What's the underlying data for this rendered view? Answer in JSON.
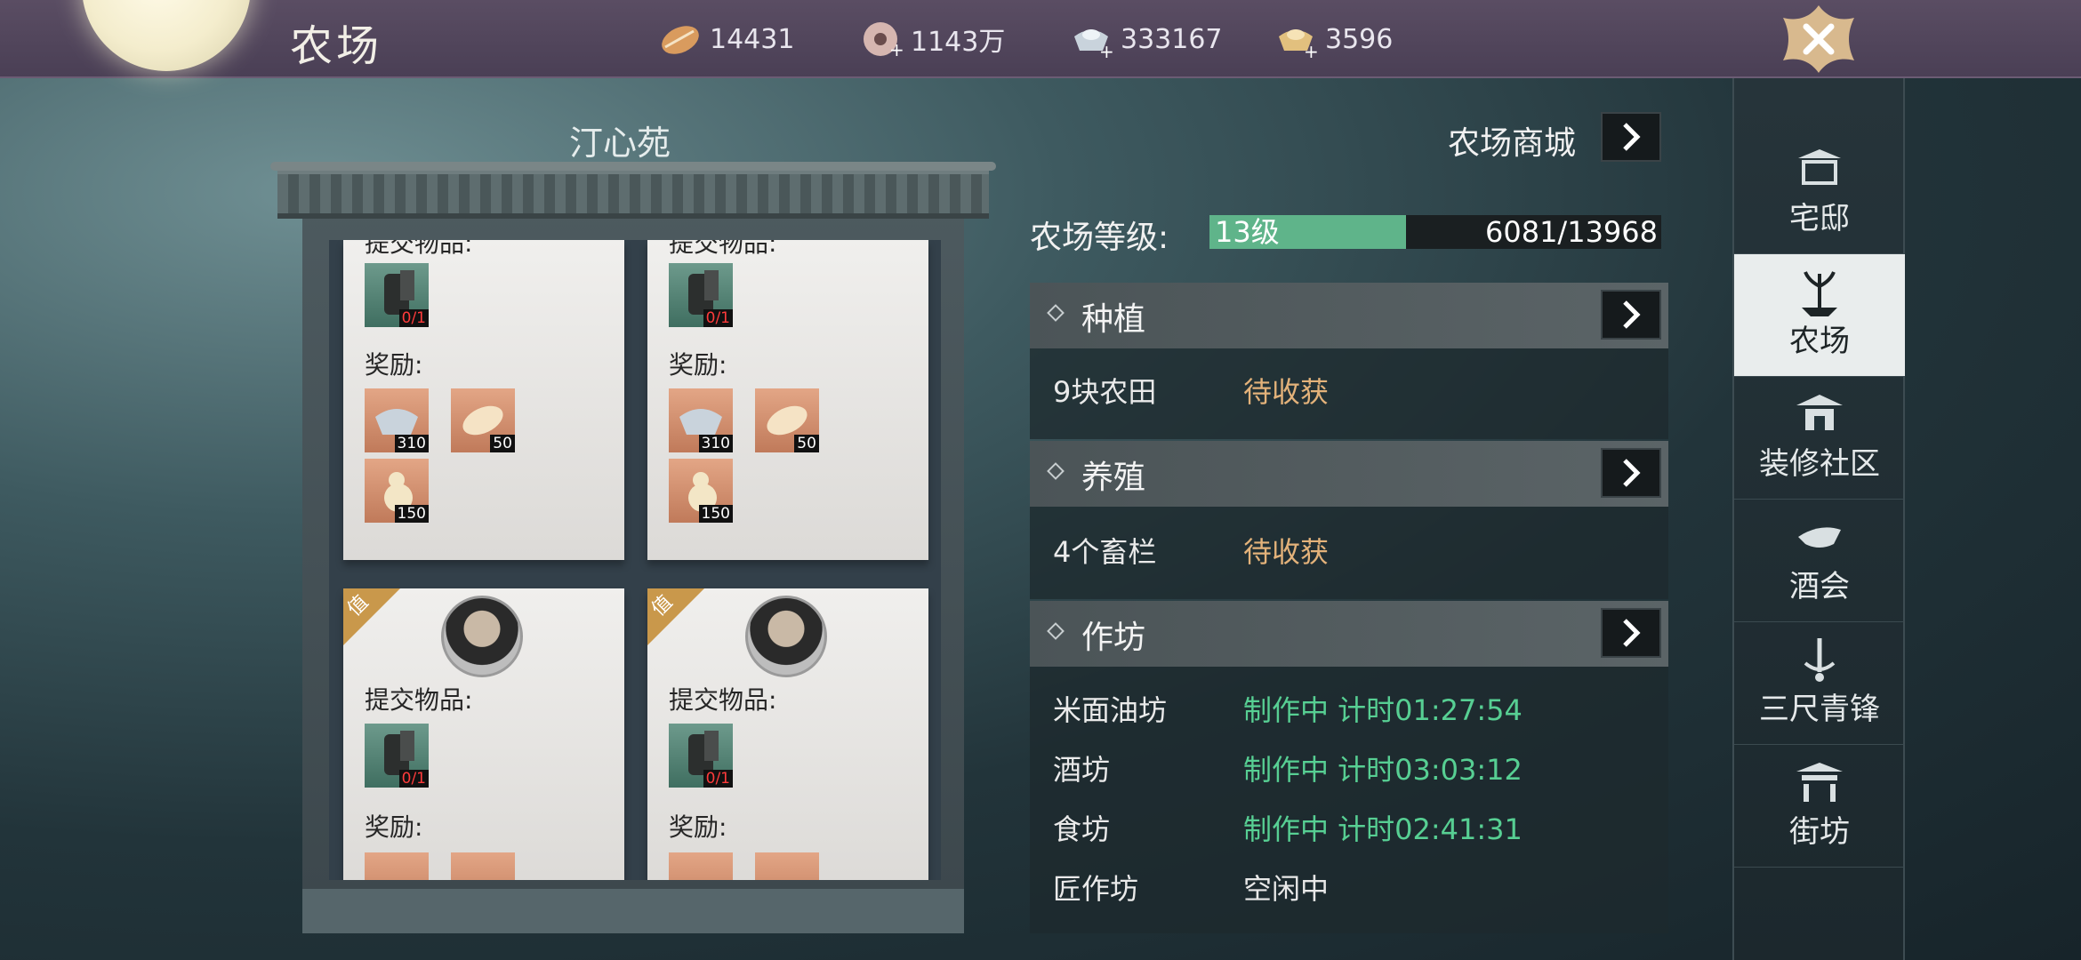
{
  "header": {
    "title": "农场",
    "resources": [
      {
        "icon": "leaf-icon",
        "value": "14431"
      },
      {
        "icon": "coin-icon",
        "value": "1143万"
      },
      {
        "icon": "silver-ingot-icon",
        "value": "333167"
      },
      {
        "icon": "gold-ingot-icon",
        "value": "3596"
      }
    ]
  },
  "garden": {
    "title": "汀心苑",
    "cards": [
      {
        "submit_label": "提交物品:",
        "item_count": "0/1",
        "reward_label": "奖励:",
        "rewards": [
          "310",
          "50",
          "150"
        ]
      },
      {
        "submit_label": "提交物品:",
        "item_count": "0/1",
        "reward_label": "奖励:",
        "rewards": [
          "310",
          "50",
          "150"
        ]
      },
      {
        "badge": "值",
        "submit_label": "提交物品:",
        "item_count": "0/1",
        "reward_label": "奖励:"
      },
      {
        "badge": "值",
        "submit_label": "提交物品:",
        "item_count": "0/1",
        "reward_label": "奖励:"
      }
    ]
  },
  "panel": {
    "shop_label": "农场商城",
    "level_label": "农场等级:",
    "level": "13级",
    "xp": "6081/13968",
    "xp_fraction": 0.435,
    "sections": [
      {
        "title": "种植",
        "rows": [
          {
            "name": "9块农田",
            "status": "待收获"
          }
        ]
      },
      {
        "title": "养殖",
        "rows": [
          {
            "name": "4个畜栏",
            "status": "待收获"
          }
        ]
      },
      {
        "title": "作坊",
        "rows": [
          {
            "name": "米面油坊",
            "status": "制作中 计时01:27:54"
          },
          {
            "name": "酒坊",
            "status": "制作中 计时03:03:12"
          },
          {
            "name": "食坊",
            "status": "制作中 计时02:41:31"
          },
          {
            "name": "匠作坊",
            "status": "空闲中"
          }
        ]
      }
    ]
  },
  "sidebar": {
    "items": [
      {
        "label": "宅邸",
        "icon": "mansion-icon"
      },
      {
        "label": "农场",
        "icon": "farm-icon",
        "active": true
      },
      {
        "label": "装修社区",
        "icon": "decor-icon"
      },
      {
        "label": "酒会",
        "icon": "banquet-icon"
      },
      {
        "label": "三尺青锋",
        "icon": "sword-icon"
      },
      {
        "label": "街坊",
        "icon": "street-icon"
      }
    ]
  },
  "colors": {
    "accent_green": "#5fb48a",
    "harvest": "#e3b27a",
    "working": "#57cf93"
  }
}
